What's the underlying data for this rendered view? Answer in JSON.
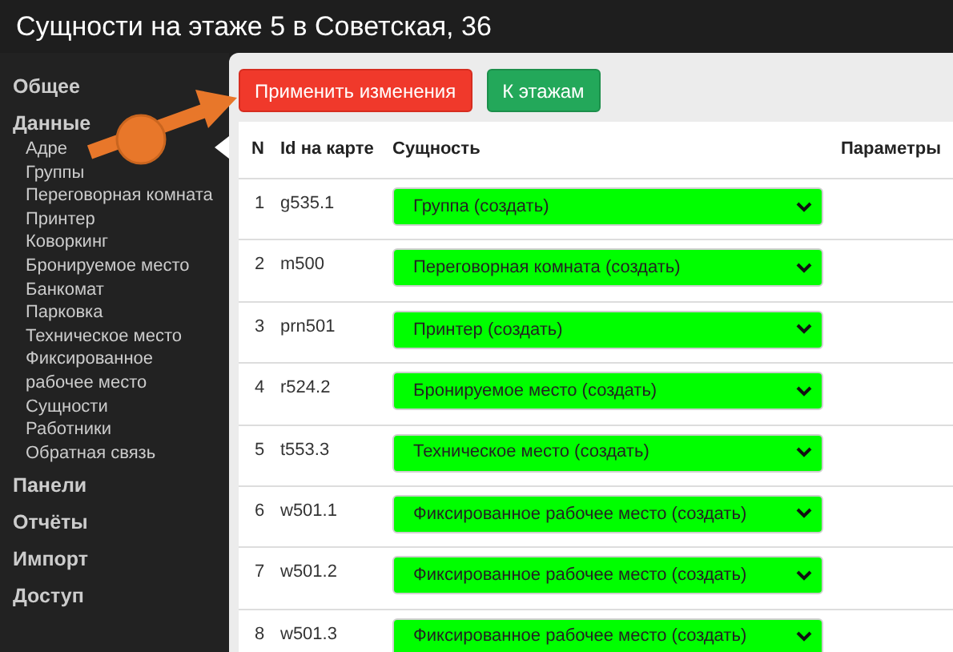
{
  "title": "Сущности на этаже 5 в Советская, 36",
  "sidebar": [
    {
      "label": "Общее"
    },
    {
      "label": "Данные",
      "children": [
        {
          "label": "Адре"
        },
        {
          "label": "Группы"
        },
        {
          "label": "Переговорная комната"
        },
        {
          "label": "Принтер"
        },
        {
          "label": "Коворкинг"
        },
        {
          "label": "Бронируемое место"
        },
        {
          "label": "Банкомат"
        },
        {
          "label": "Парковка"
        },
        {
          "label": "Техническое место"
        },
        {
          "label": "Фиксированное рабочее место"
        },
        {
          "label": "Сущности"
        },
        {
          "label": "Работники"
        },
        {
          "label": "Обратная связь"
        }
      ]
    },
    {
      "label": "Панели"
    },
    {
      "label": "Отчёты"
    },
    {
      "label": "Импорт"
    },
    {
      "label": "Доступ"
    }
  ],
  "buttons": [
    {
      "label": "Применить изменения",
      "kind": "danger"
    },
    {
      "label": "К этажам",
      "kind": "success"
    }
  ],
  "table": {
    "columns": [
      "N",
      "Id на карте",
      "Сущность",
      "Параметры"
    ],
    "rows": [
      {
        "n": "1",
        "id": "g535.1",
        "entity": "Группа (создать)"
      },
      {
        "n": "2",
        "id": "m500",
        "entity": "Переговорная комната (создать)"
      },
      {
        "n": "3",
        "id": "prn501",
        "entity": "Принтер (создать)"
      },
      {
        "n": "4",
        "id": "r524.2",
        "entity": "Бронируемое место (создать)"
      },
      {
        "n": "5",
        "id": "t553.3",
        "entity": "Техническое место (создать)"
      },
      {
        "n": "6",
        "id": "w501.1",
        "entity": "Фиксированное рабочее место (создать)"
      },
      {
        "n": "7",
        "id": "w501.2",
        "entity": "Фиксированное рабочее место (создать)"
      },
      {
        "n": "8",
        "id": "w501.3",
        "entity": "Фиксированное рабочее место (создать)"
      }
    ]
  }
}
